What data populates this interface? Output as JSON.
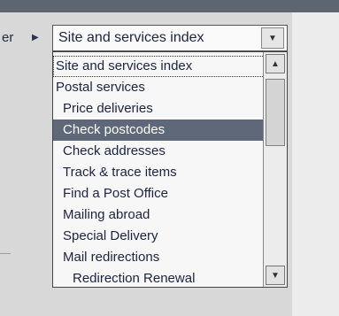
{
  "left": {
    "label": "er",
    "arrow_icon": "right-triangle-icon"
  },
  "select": {
    "value": "Site and services index",
    "button_icon": "chevron-down-icon"
  },
  "dropdown": {
    "options": [
      {
        "label": "Site and services index"
      },
      {
        "label": "Postal services"
      },
      {
        "label": "Price deliveries"
      },
      {
        "label": "Check postcodes"
      },
      {
        "label": "Check addresses"
      },
      {
        "label": "Track & trace items"
      },
      {
        "label": "Find a Post Office"
      },
      {
        "label": "Mailing abroad"
      },
      {
        "label": "Special Delivery"
      },
      {
        "label": "Mail redirections"
      },
      {
        "label": "Redirection Renewal"
      }
    ],
    "selected_option": "Check postcodes"
  },
  "scrollbar": {
    "up_icon": "scroll-up-icon",
    "down_icon": "scroll-down-icon"
  },
  "colors": {
    "selection": "#5e6878",
    "top_strip": "#5c6570"
  }
}
